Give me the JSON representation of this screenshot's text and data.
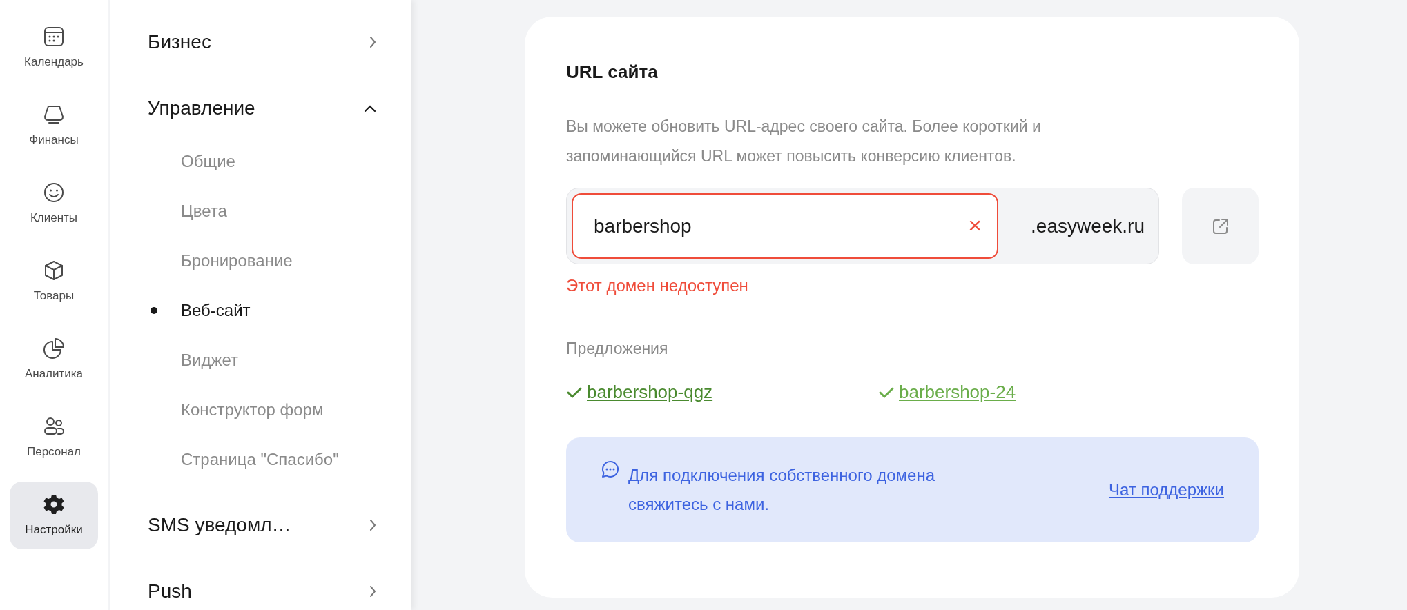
{
  "rail": [
    {
      "label": "Календарь",
      "kind": "calendar",
      "selected": false
    },
    {
      "label": "Финансы",
      "kind": "finance",
      "selected": false
    },
    {
      "label": "Клиенты",
      "kind": "smile",
      "selected": false
    },
    {
      "label": "Товары",
      "kind": "box",
      "selected": false
    },
    {
      "label": "Аналитика",
      "kind": "pie",
      "selected": false
    },
    {
      "label": "Персонал",
      "kind": "people",
      "selected": false
    },
    {
      "label": "Настройки",
      "kind": "gear",
      "selected": true
    }
  ],
  "sidebar": {
    "groups": [
      {
        "label": "Бизнес",
        "expanded": false
      },
      {
        "label": "Управление",
        "expanded": true,
        "children": [
          {
            "label": "Общие",
            "selected": false
          },
          {
            "label": "Цвета",
            "selected": false
          },
          {
            "label": "Бронирование",
            "selected": false
          },
          {
            "label": "Веб-сайт",
            "selected": true
          },
          {
            "label": "Виджет",
            "selected": false
          },
          {
            "label": "Конструктор форм",
            "selected": false
          },
          {
            "label": "Страница \"Спасибо\"",
            "selected": false
          }
        ]
      },
      {
        "label": "SMS уведомл…",
        "expanded": false
      },
      {
        "label": "Push",
        "expanded": false
      }
    ]
  },
  "card": {
    "title": "URL сайта",
    "description": "Вы можете обновить URL-адрес своего сайта. Более короткий и запоминающийся URL может повысить конверсию клиентов.",
    "input": {
      "value": "barbershop",
      "invalid": true
    },
    "clear": "×",
    "suffix": ".easyweek.ru",
    "error": "Этот домен недоступен",
    "suggestions_label": "Предложения",
    "suggestions": [
      {
        "text": "barbershop-qgz",
        "color": "#4a8a2f"
      },
      {
        "text": "barbershop-24",
        "color": "#6aad4a"
      }
    ],
    "info": {
      "text": "Для подключения собственного домена свяжитесь с нами.",
      "link": "Чат поддержки"
    }
  }
}
